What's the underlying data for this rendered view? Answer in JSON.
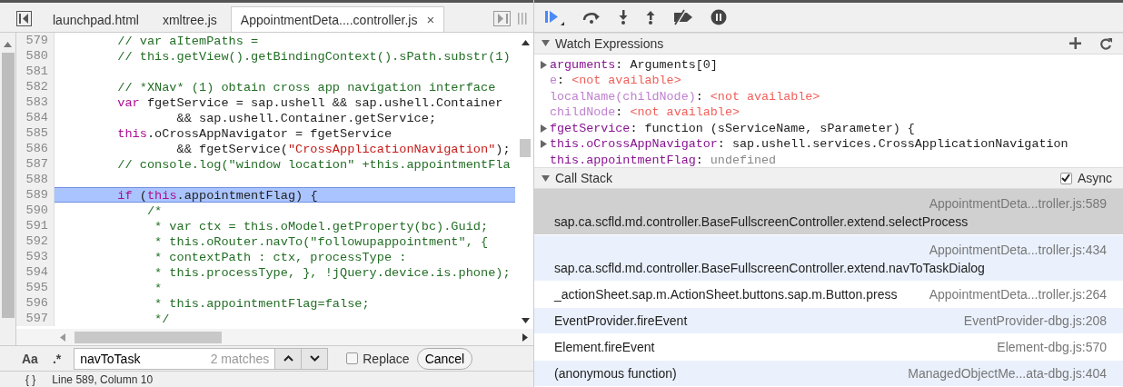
{
  "editor": {
    "tabs": [
      {
        "label": "launchpad.html",
        "selected": false,
        "closable": false
      },
      {
        "label": "xmltree.js",
        "selected": false,
        "closable": false
      },
      {
        "label": "AppointmentDeta....controller.js",
        "selected": true,
        "closable": true,
        "close": "×"
      }
    ],
    "lines": [
      {
        "number": "579",
        "highlighted": false,
        "segments": [
          {
            "kind": "comment",
            "text": "        // var aItemPaths ="
          }
        ]
      },
      {
        "number": "580",
        "highlighted": false,
        "segments": [
          {
            "kind": "comment",
            "text": "        // this.getView().getBindingContext().sPath.substr(1)"
          }
        ]
      },
      {
        "number": "581",
        "highlighted": false
      },
      {
        "number": "582",
        "highlighted": false,
        "segments": [
          {
            "kind": "comment",
            "text": "        // *XNav* (1) obtain cross app navigation interface"
          }
        ]
      },
      {
        "number": "583",
        "highlighted": false,
        "segments": [
          {
            "kind": "keyword",
            "text": "        var"
          },
          {
            "kind": "plain",
            "text": " fgetService = sap.ushell && sap.ushell.Container"
          }
        ]
      },
      {
        "number": "584",
        "highlighted": false,
        "segments": [
          {
            "kind": "plain",
            "text": "                && sap.ushell.Container.getService;"
          }
        ]
      },
      {
        "number": "585",
        "highlighted": false,
        "segments": [
          {
            "kind": "keyword",
            "text": "        this"
          },
          {
            "kind": "plain",
            "text": ".oCrossAppNavigator = fgetService"
          }
        ]
      },
      {
        "number": "586",
        "highlighted": false,
        "segments": [
          {
            "kind": "plain",
            "text": "                && fgetService("
          },
          {
            "kind": "string",
            "text": "\"CrossApplicationNavigation\""
          },
          {
            "kind": "plain",
            "text": ");"
          }
        ]
      },
      {
        "number": "587",
        "highlighted": false,
        "segments": [
          {
            "kind": "comment",
            "text": "        // console.log(\"window location\" +this.appointmentFla"
          }
        ]
      },
      {
        "number": "588",
        "highlighted": false
      },
      {
        "number": "589",
        "highlighted": true,
        "segments": [
          {
            "kind": "keyword",
            "text": "        if"
          },
          {
            "kind": "plain",
            "text": " ("
          },
          {
            "kind": "keyword",
            "text": "this"
          },
          {
            "kind": "plain",
            "text": ".appointmentFlag) {"
          }
        ]
      },
      {
        "number": "590",
        "highlighted": false,
        "segments": [
          {
            "kind": "comment",
            "text": "            /*"
          }
        ]
      },
      {
        "number": "591",
        "highlighted": false,
        "segments": [
          {
            "kind": "comment",
            "text": "             * var ctx = this.oModel.getProperty(bc).Guid;"
          }
        ]
      },
      {
        "number": "592",
        "highlighted": false,
        "segments": [
          {
            "kind": "comment",
            "text": "             * this.oRouter.navTo(\"followupappointment\", {"
          }
        ]
      },
      {
        "number": "593",
        "highlighted": false,
        "segments": [
          {
            "kind": "comment",
            "text": "             * contextPath : ctx, processType :"
          }
        ]
      },
      {
        "number": "594",
        "highlighted": false,
        "segments": [
          {
            "kind": "comment",
            "text": "             * this.processType, }, !jQuery.device.is.phone);"
          }
        ]
      },
      {
        "number": "595",
        "highlighted": false,
        "segments": [
          {
            "kind": "comment",
            "text": "             *"
          }
        ]
      },
      {
        "number": "596",
        "highlighted": false,
        "segments": [
          {
            "kind": "comment",
            "text": "             * this.appointmentFlag=false;"
          }
        ]
      },
      {
        "number": "597",
        "highlighted": false,
        "segments": [
          {
            "kind": "comment",
            "text": "             */"
          }
        ]
      }
    ],
    "find": {
      "case_label": "Aa",
      "regex_label": ".*",
      "value": "navToTask",
      "matches": "2 matches",
      "replace": {
        "label": "Replace",
        "checked": false
      },
      "cancel": "Cancel"
    },
    "status": {
      "braces": "{ }",
      "position": "Line 589, Column 10"
    }
  },
  "debugger": {
    "watch": {
      "title": "Watch Expressions",
      "expanded": true,
      "items": [
        {
          "kind": "object",
          "expandable": true,
          "name": "arguments",
          "separator": ":",
          "value": "Arguments[0]"
        },
        {
          "kind": "unavailable",
          "expandable": false,
          "name": "e",
          "separator": ":",
          "value": "<not available>"
        },
        {
          "kind": "unavailable",
          "expandable": false,
          "name": "localName(childNode)",
          "separator": ":",
          "value": "<not available>"
        },
        {
          "kind": "unavailable",
          "expandable": false,
          "name": "childNode",
          "separator": ":",
          "value": "<not available>"
        },
        {
          "kind": "object",
          "expandable": true,
          "name": "fgetService",
          "separator": ":",
          "value": "function (sServiceName, sParameter) {"
        },
        {
          "kind": "object",
          "expandable": true,
          "name": "this.oCrossAppNavigator",
          "separator": ":",
          "value": "sap.ushell.services.CrossApplicationNavigation"
        },
        {
          "kind": "undefined",
          "expandable": false,
          "name": "this.appointmentFlag",
          "separator": ":",
          "value": "undefined"
        }
      ]
    },
    "call_stack": {
      "title": "Call Stack",
      "expanded": true,
      "async": {
        "label": "Async",
        "checked": true
      },
      "frames": [
        {
          "function": "sap.ca.scfld.md.controller.BaseFullscreenController.extend.selectProcess",
          "location": "AppointmentDeta...troller.js:589",
          "selected": true,
          "wrapped": true
        },
        {
          "function": "sap.ca.scfld.md.controller.BaseFullscreenController.extend.navToTaskDialog",
          "location": "AppointmentDeta...troller.js:434",
          "selected": false,
          "wrapped": true
        },
        {
          "function": "_actionSheet.sap.m.ActionSheet.buttons.sap.m.Button.press",
          "location": "AppointmentDeta...troller.js:264",
          "selected": false,
          "wrapped": false
        },
        {
          "function": "EventProvider.fireEvent",
          "location": "EventProvider-dbg.js:208",
          "selected": false,
          "wrapped": false
        },
        {
          "function": "Element.fireEvent",
          "location": "Element-dbg.js:570",
          "selected": false,
          "wrapped": false
        },
        {
          "function": "(anonymous function)",
          "location": "ManagedObjectMe...ata-dbg.js:404",
          "selected": false,
          "wrapped": false
        }
      ]
    }
  }
}
